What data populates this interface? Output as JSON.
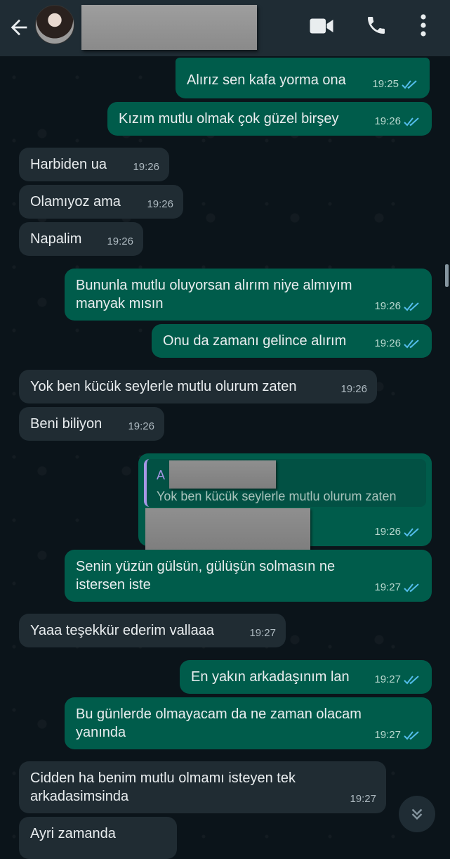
{
  "header": {
    "back_icon": "arrow-left-icon",
    "video_icon": "video-camera-icon",
    "call_icon": "phone-icon",
    "menu_icon": "more-vertical-icon"
  },
  "colors": {
    "header_bg": "#1f2c34",
    "incoming_bubble": "#202c33",
    "outgoing_bubble": "#005c4b",
    "read_ticks": "#53bdeb",
    "quote_accent": "#a797e6"
  },
  "messages": [
    {
      "dir": "out",
      "text": "Alırız sen kafa yorma ona",
      "time": "19:25",
      "read": true
    },
    {
      "dir": "out",
      "text": "Kızım mutlu olmak çok güzel birşey",
      "time": "19:26",
      "read": true
    },
    {
      "dir": "in",
      "text": "Harbiden ua",
      "time": "19:26"
    },
    {
      "dir": "in",
      "text": "Olamıyoz ama",
      "time": "19:26"
    },
    {
      "dir": "in",
      "text": "Napalim",
      "time": "19:26"
    },
    {
      "dir": "out",
      "text": "Bununla mutlu oluyorsan alırım niye almıyım manyak mısın",
      "time": "19:26",
      "read": true
    },
    {
      "dir": "out",
      "text": "Onu da zamanı gelince alırım",
      "time": "19:26",
      "read": true
    },
    {
      "dir": "in",
      "text": "Yok ben kücük seylerle mutlu olurum zaten",
      "time": "19:26"
    },
    {
      "dir": "in",
      "text": "Beni biliyon",
      "time": "19:26"
    },
    {
      "dir": "out",
      "reply": true,
      "quote_author": "A",
      "quote_text": "Yok ben kücük seylerle mutlu olurum zaten",
      "time": "19:26",
      "read": true
    },
    {
      "dir": "out",
      "text": "Senin yüzün gülsün, gülüşün solmasın ne istersen iste",
      "time": "19:27",
      "read": true
    },
    {
      "dir": "in",
      "text": "Yaaa teşekkür ederim vallaaa",
      "time": "19:27"
    },
    {
      "dir": "out",
      "text": "En yakın arkadaşınım lan",
      "time": "19:27",
      "read": true
    },
    {
      "dir": "out",
      "text": "Bu günlerde olmayacam da ne zaman olacam yanında",
      "time": "19:27",
      "read": true
    },
    {
      "dir": "in",
      "text": "Cidden ha benim mutlu olmamı isteyen tek arkadasimsinda",
      "time": "19:27"
    },
    {
      "dir": "in",
      "text": "Ayri zamanda",
      "time": ""
    }
  ],
  "scroll_button_icon": "double-chevron-down-icon"
}
